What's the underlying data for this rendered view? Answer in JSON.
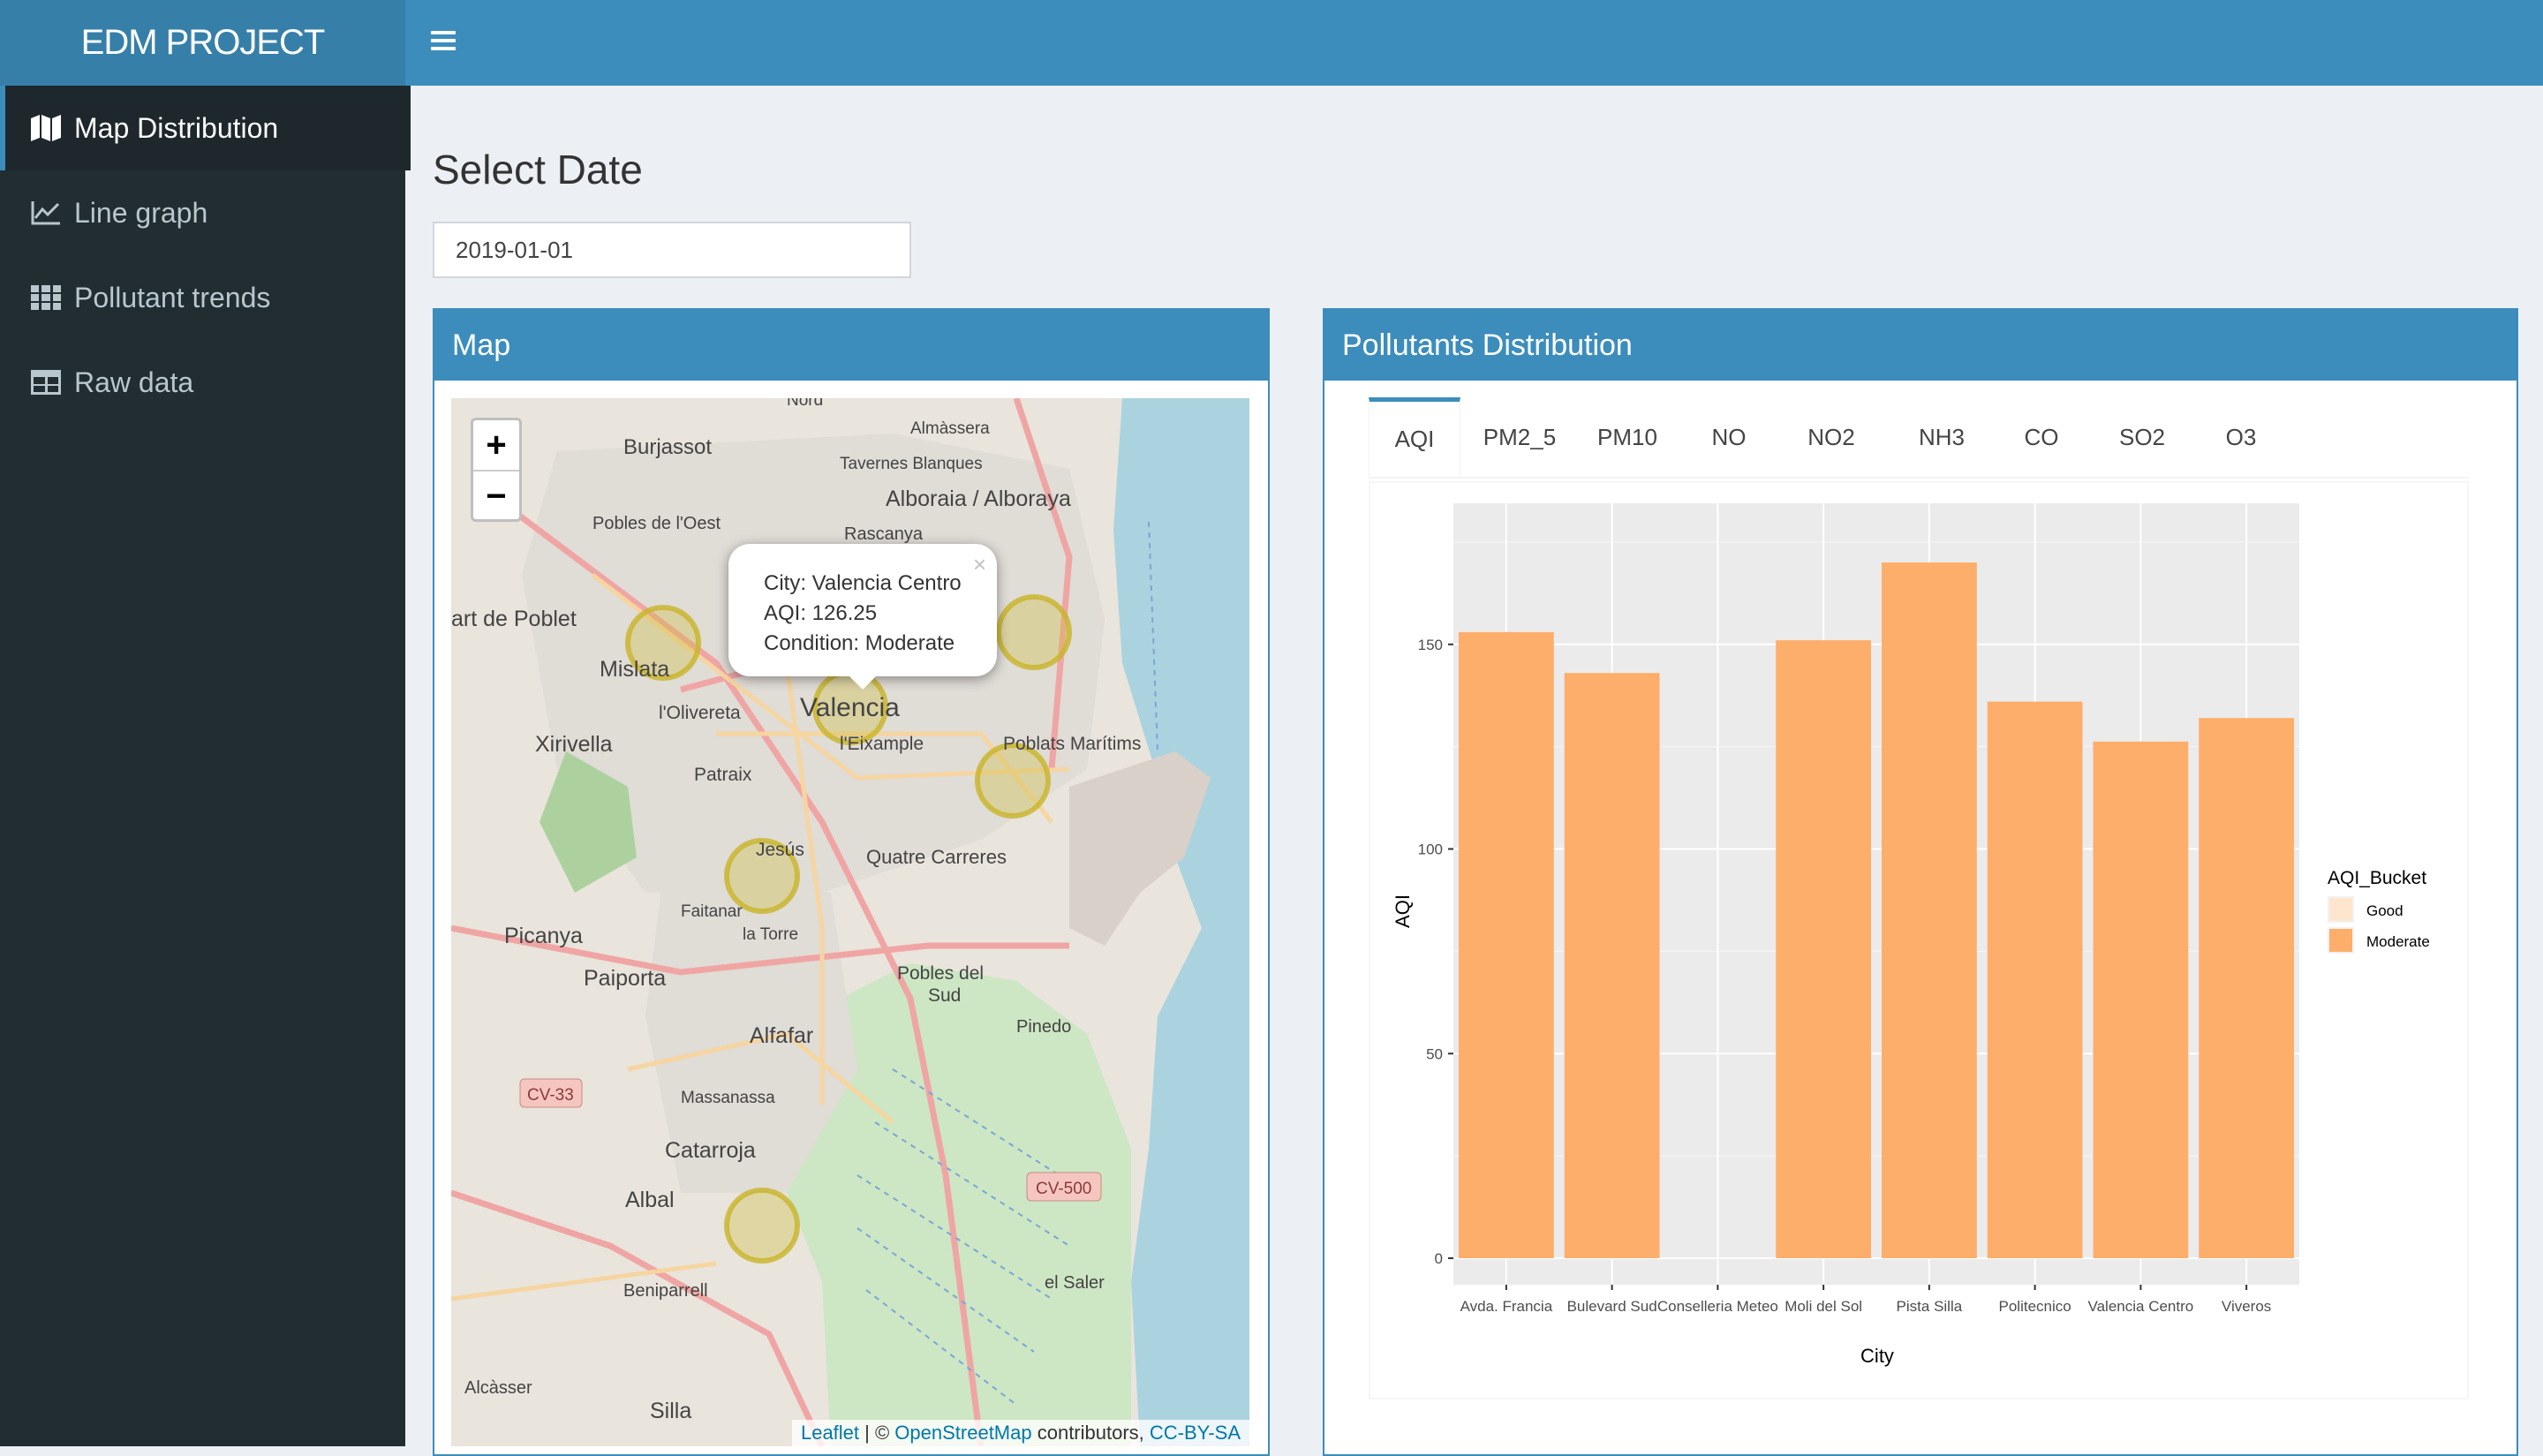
{
  "app": {
    "title": "EDM PROJECT"
  },
  "sidebar": {
    "items": [
      {
        "label": "Map Distribution",
        "icon": "map-icon",
        "active": true
      },
      {
        "label": "Line graph",
        "icon": "line-chart-icon",
        "active": false
      },
      {
        "label": "Pollutant trends",
        "icon": "th-grid-icon",
        "active": false
      },
      {
        "label": "Raw data",
        "icon": "table-icon",
        "active": false
      }
    ]
  },
  "main": {
    "title": "Select Date",
    "date_value": "2019-01-01"
  },
  "map_box": {
    "title": "Map",
    "zoom_in": "+",
    "zoom_out": "−",
    "popup": {
      "city": "City: Valencia Centro",
      "aqi": "AQI: 126.25",
      "condition": "Condition: Moderate",
      "close": "×"
    },
    "labels": [
      "Burjassot",
      "Almàssera",
      "Tavernes Blanques",
      "Alboraia / Alboraya",
      "Pobles de l'Oest",
      "Rascanya",
      "art de Poblet",
      "Mislata",
      "l'Olivereta",
      "Valencia",
      "l'Eixample",
      "Poblats Marítims",
      "Xirivella",
      "Patraix",
      "Jesús",
      "Quatre Carreres",
      "Faitanar",
      "la Torre",
      "Picanya",
      "Paiporta",
      "Pobles del Sud",
      "Alfafar",
      "Pinedo",
      "CV-33",
      "Massanassa",
      "Catarroja",
      "CV-500",
      "Albal",
      "Beniparrell",
      "el Saler",
      "Alcàsser",
      "Silla",
      "Nord"
    ],
    "attribution": {
      "leaflet": "Leaflet",
      "sep": " | © ",
      "osm": "OpenStreetMap",
      "contrib": " contributors, ",
      "license": "CC-BY-SA"
    }
  },
  "chart_box": {
    "title": "Pollutants Distribution",
    "tabs": [
      "AQI",
      "PM2_5",
      "PM10",
      "NO",
      "NO2",
      "NH3",
      "CO",
      "SO2",
      "O3"
    ],
    "active_tab": "AQI"
  },
  "colors": {
    "header": "#3c8dbc",
    "sidebar": "#222d32",
    "bar": "#fdae6b",
    "good": "#fee6ce"
  },
  "chart_data": {
    "type": "bar",
    "categories": [
      "Avda. Francia",
      "Bulevard Sud",
      "Conselleria Meteo",
      "Moli del Sol",
      "Pista Silla",
      "Politecnico",
      "Valencia Centro",
      "Viveros"
    ],
    "values": [
      153,
      143,
      0,
      151,
      170,
      136,
      126.25,
      132
    ],
    "xlabel": "City",
    "ylabel": "AQI",
    "ylim": [
      0,
      180
    ],
    "yticks": [
      0,
      50,
      100,
      150
    ],
    "legend": {
      "title": "AQI_Bucket",
      "entries": [
        "Good",
        "Moderate"
      ]
    },
    "grid": true
  }
}
